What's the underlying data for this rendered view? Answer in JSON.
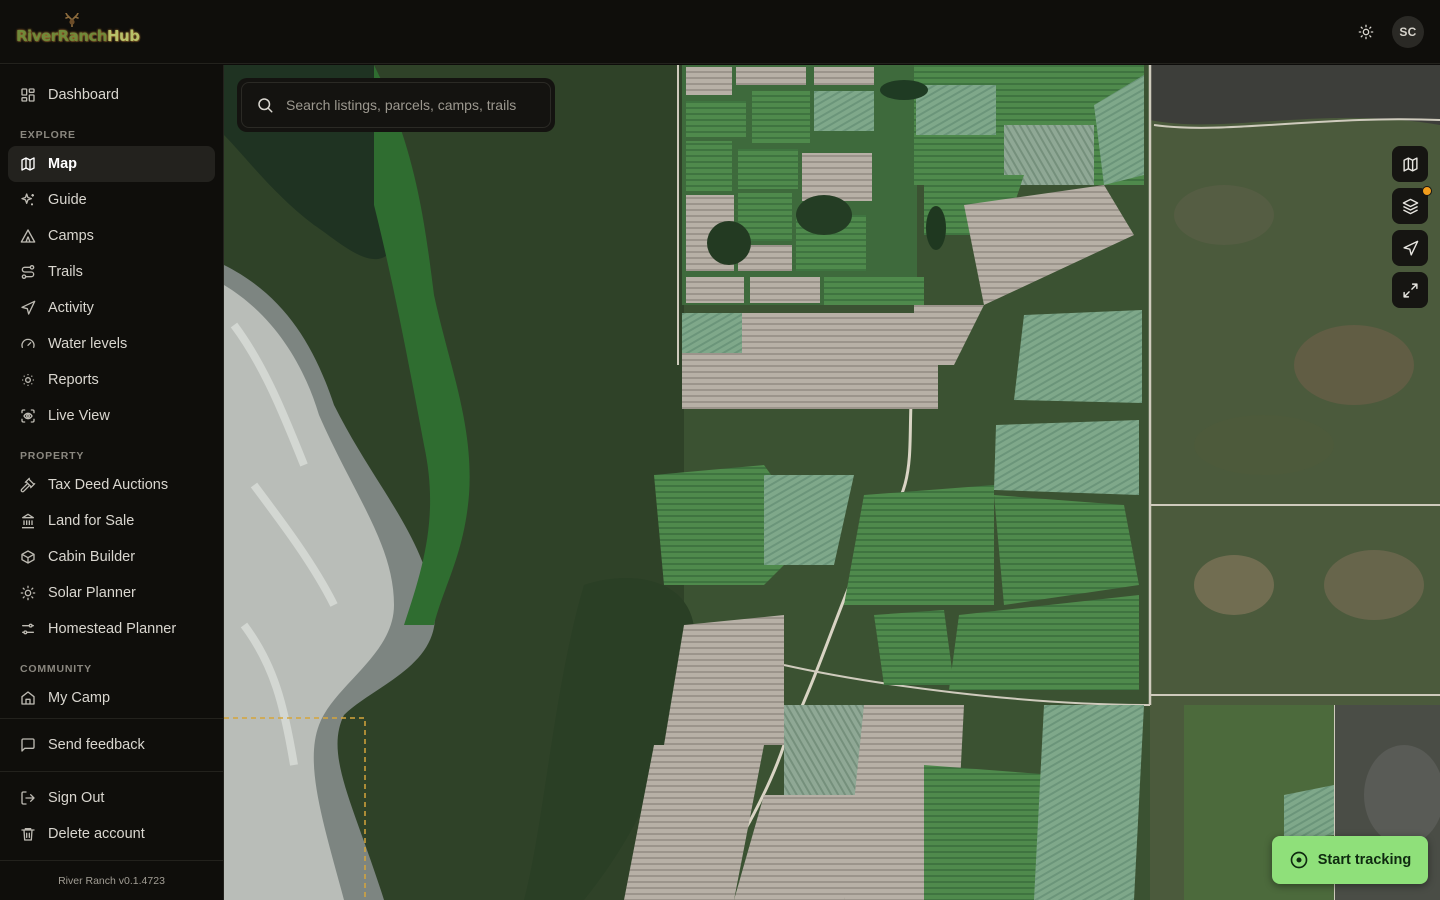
{
  "app": {
    "logo_text_a": "RiverRanch",
    "logo_text_b": "Hub",
    "avatar_initials": "SC",
    "version": "River Ranch v0.1.4723"
  },
  "sidebar": {
    "dashboard": "Dashboard",
    "sections": {
      "explore": "EXPLORE",
      "property": "PROPERTY",
      "community": "COMMUNITY"
    },
    "explore_items": [
      {
        "label": "Map",
        "icon": "map-icon",
        "active": true
      },
      {
        "label": "Guide",
        "icon": "sparkles-icon"
      },
      {
        "label": "Camps",
        "icon": "tent-icon"
      },
      {
        "label": "Trails",
        "icon": "route-icon"
      },
      {
        "label": "Activity",
        "icon": "navigation-icon"
      },
      {
        "label": "Water levels",
        "icon": "gauge-icon"
      },
      {
        "label": "Reports",
        "icon": "sun-dim-icon"
      },
      {
        "label": "Live View",
        "icon": "scan-eye-icon"
      }
    ],
    "property_items": [
      {
        "label": "Tax Deed Auctions",
        "icon": "gavel-icon"
      },
      {
        "label": "Land for Sale",
        "icon": "landmark-icon"
      },
      {
        "label": "Cabin Builder",
        "icon": "box-icon"
      },
      {
        "label": "Solar Planner",
        "icon": "sun-icon"
      },
      {
        "label": "Homestead Planner",
        "icon": "sliders-icon"
      }
    ],
    "community_items": [
      {
        "label": "My Camp",
        "icon": "home-icon"
      }
    ],
    "feedback": "Send feedback",
    "sign_out": "Sign Out",
    "delete_account": "Delete account"
  },
  "map": {
    "search_placeholder": "Search listings, parcels, camps, trails",
    "start_tracking": "Start tracking",
    "controls": [
      "basemap-icon",
      "layers-icon",
      "locate-icon",
      "fullscreen-icon"
    ],
    "layers_badge_color": "#f29d1c"
  },
  "colors": {
    "accent": "#8fe07a",
    "background": "#0f0e0b"
  }
}
